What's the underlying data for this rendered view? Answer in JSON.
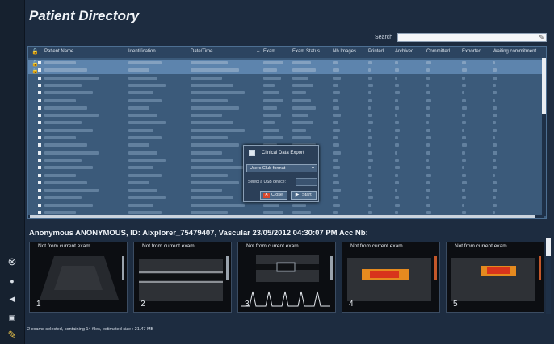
{
  "window": {
    "title": "Patient Directory"
  },
  "search": {
    "label": "Search",
    "value": ""
  },
  "table": {
    "columns": [
      "Patient Name",
      "Identification",
      "Date/Time",
      "Exam",
      "Exam Status",
      "Nb Images",
      "Printed",
      "Archived",
      "Committed",
      "Exported",
      "Waiting commitment"
    ]
  },
  "dialog": {
    "title": "Clinical Data Export",
    "format_value": "Users Club format",
    "usb_label": "Select a USB device:",
    "close_label": "Close",
    "start_label": "Start"
  },
  "selected_exam": {
    "summary": "Anonymous ANONYMOUS, ID: Aixplorer_75479407, Vascular 23/05/2012 04:30:07 PM Acc Nb:"
  },
  "thumbnails": [
    {
      "header": "Not from current exam",
      "number": "1"
    },
    {
      "header": "Not from current exam",
      "number": "2"
    },
    {
      "header": "Not from current exam",
      "number": "3"
    },
    {
      "header": "Not from current exam",
      "number": "4"
    },
    {
      "header": "Not from current exam",
      "number": "5"
    }
  ],
  "status": {
    "text": "2 exams selected, containing 14 files, estimated size : 21.47 MB"
  },
  "icons": {
    "lock": "lock-icon",
    "close": "close-icon",
    "play": "play-icon",
    "brush": "brush-icon",
    "camera": "camera-icon",
    "menu": "menu-icon"
  }
}
